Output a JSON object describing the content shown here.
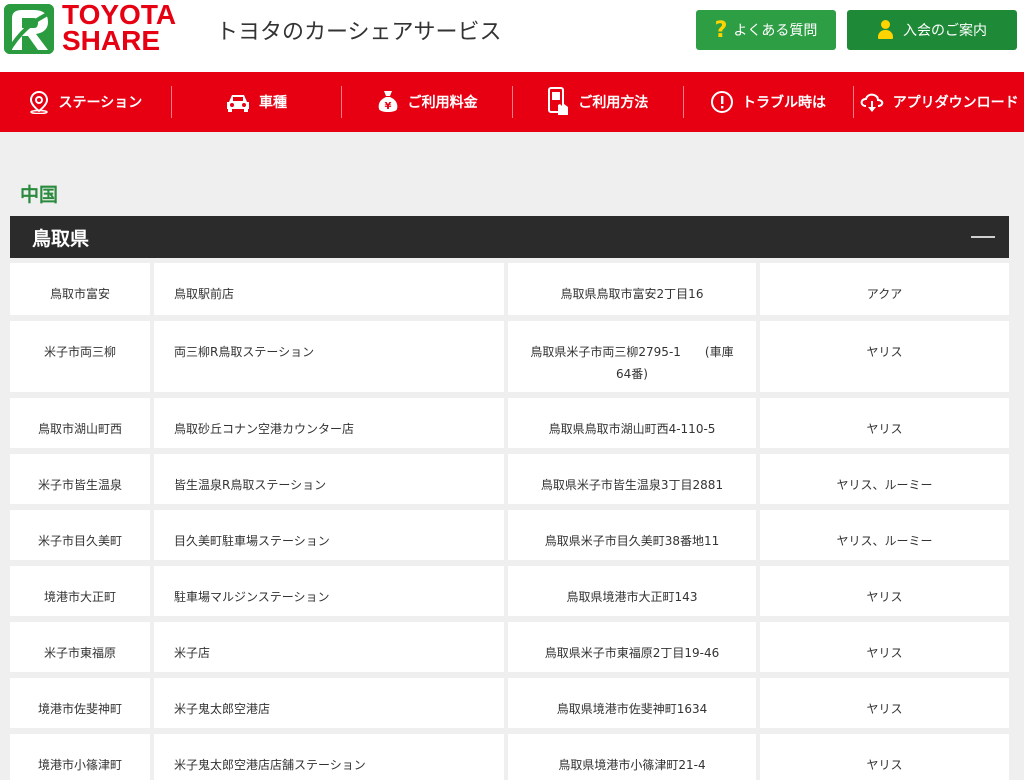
{
  "header": {
    "logo_line1": "TOYOTA",
    "logo_line2": "SHARE",
    "tagline": "トヨタのカーシェアサービス",
    "faq_label": "よくある質問",
    "join_label": "入会のご案内"
  },
  "nav": {
    "items": [
      {
        "label": "ステーション",
        "icon": "map-pin-icon"
      },
      {
        "label": "車種",
        "icon": "car-icon"
      },
      {
        "label": "ご利用料金",
        "icon": "money-bag-icon"
      },
      {
        "label": "ご利用方法",
        "icon": "smartphone-hand-icon"
      },
      {
        "label": "トラブル時は",
        "icon": "exclamation-circle-icon"
      },
      {
        "label": "アプリダウンロード",
        "icon": "cloud-download-icon"
      }
    ]
  },
  "region": "中国",
  "prefecture": "鳥取県",
  "stations": [
    {
      "area": "鳥取市富安",
      "name": "鳥取駅前店",
      "address": "鳥取県鳥取市富安2丁目16",
      "cars": "アクア"
    },
    {
      "area": "米子市両三柳",
      "name": "両三柳R鳥取ステーション",
      "address": "鳥取県米子市両三柳2795-1　　(車庫64番)",
      "cars": "ヤリス"
    },
    {
      "area": "鳥取市湖山町西",
      "name": "鳥取砂丘コナン空港カウンター店",
      "address": "鳥取県鳥取市湖山町西4-110-5",
      "cars": "ヤリス"
    },
    {
      "area": "米子市皆生温泉",
      "name": "皆生温泉R鳥取ステーション",
      "address": "鳥取県米子市皆生温泉3丁目2881",
      "cars": "ヤリス、ルーミー"
    },
    {
      "area": "米子市目久美町",
      "name": "目久美町駐車場ステーション",
      "address": "鳥取県米子市目久美町38番地11",
      "cars": "ヤリス、ルーミー"
    },
    {
      "area": "境港市大正町",
      "name": "駐車場マルジンステーション",
      "address": "鳥取県境港市大正町143",
      "cars": "ヤリス"
    },
    {
      "area": "米子市東福原",
      "name": "米子店",
      "address": "鳥取県米子市東福原2丁目19-46",
      "cars": "ヤリス"
    },
    {
      "area": "境港市佐斐神町",
      "name": "米子鬼太郎空港店",
      "address": "鳥取県境港市佐斐神町1634",
      "cars": "ヤリス"
    },
    {
      "area": "境港市小篠津町",
      "name": "米子鬼太郎空港店店舗ステーション",
      "address": "鳥取県境港市小篠津町21-4",
      "cars": "ヤリス"
    }
  ],
  "colors": {
    "brand_red": "#e60012",
    "brand_green": "#2e9e45",
    "dark_bar": "#2b2b2b"
  }
}
